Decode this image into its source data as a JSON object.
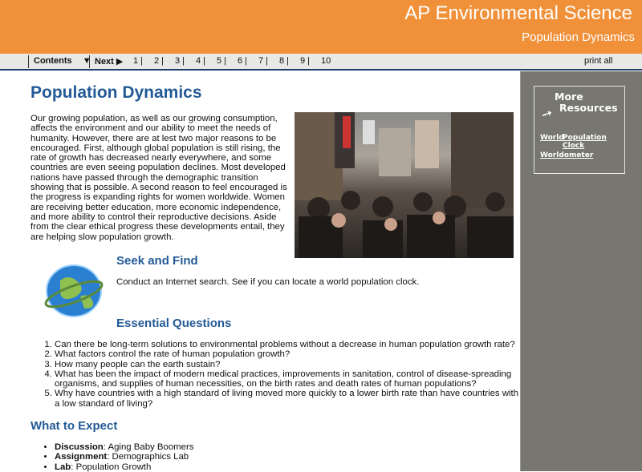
{
  "header": {
    "title": "AP Environmental Science",
    "subtitle": "Population Dynamics"
  },
  "nav": {
    "contents": "Contents",
    "next": "Next",
    "pages": [
      "1",
      "2",
      "3",
      "4",
      "5",
      "6",
      "7",
      "8",
      "9",
      "10"
    ],
    "print_all": "print all"
  },
  "main": {
    "title": "Population Dynamics",
    "intro": "Our growing population, as well as our growing consumption, affects the environment and our ability to meet the needs of humanity. However, there are at lest two major reasons to be encouraged. First, although global population is still rising, the rate of growth has decreased nearly everywhere, and some countries are even seeing population declines. Most developed nations have passed through the demographic transition showing that is possible. A second reason to feel encouraged is the progress is expanding rights for women worldwide. Women are receiving better education, more economic independence, and more ability to control their reproductive decisions. Aside from the clear ethical progress these developments entail, they are helping slow population growth.",
    "seek_title": "Seek and Find",
    "seek_text": "Conduct an Internet search. See if you can locate a world population clock.",
    "eq_title": "Essential Questions",
    "questions": [
      "Can there be long-term solutions to environmental problems without a decrease in human population growth rate?",
      "What factors control the rate of human population growth?",
      "How many people can the earth sustain?",
      "What has been the impact of modern medical practices, improvements in sanitation, control of disease-spreading organisms, and supplies of human necessities, on the birth rates and death rates of human populations?",
      "Why have countries with a high standard of living moved more quickly to a lower birth rate than have countries with a low standard of living?"
    ],
    "expect_title": "What to Expect",
    "expect": [
      {
        "label": "Discussion",
        "text": ": Aging Baby Boomers"
      },
      {
        "label": "Assignment",
        "text": ": Demographics Lab"
      },
      {
        "label": "Lab",
        "text": ": Population Growth"
      }
    ]
  },
  "sidebar": {
    "title_1": "More",
    "title_2": "Resources",
    "link_world": "World",
    "link_clock": "Population Clock",
    "link_worldometer": "Worldometer"
  }
}
